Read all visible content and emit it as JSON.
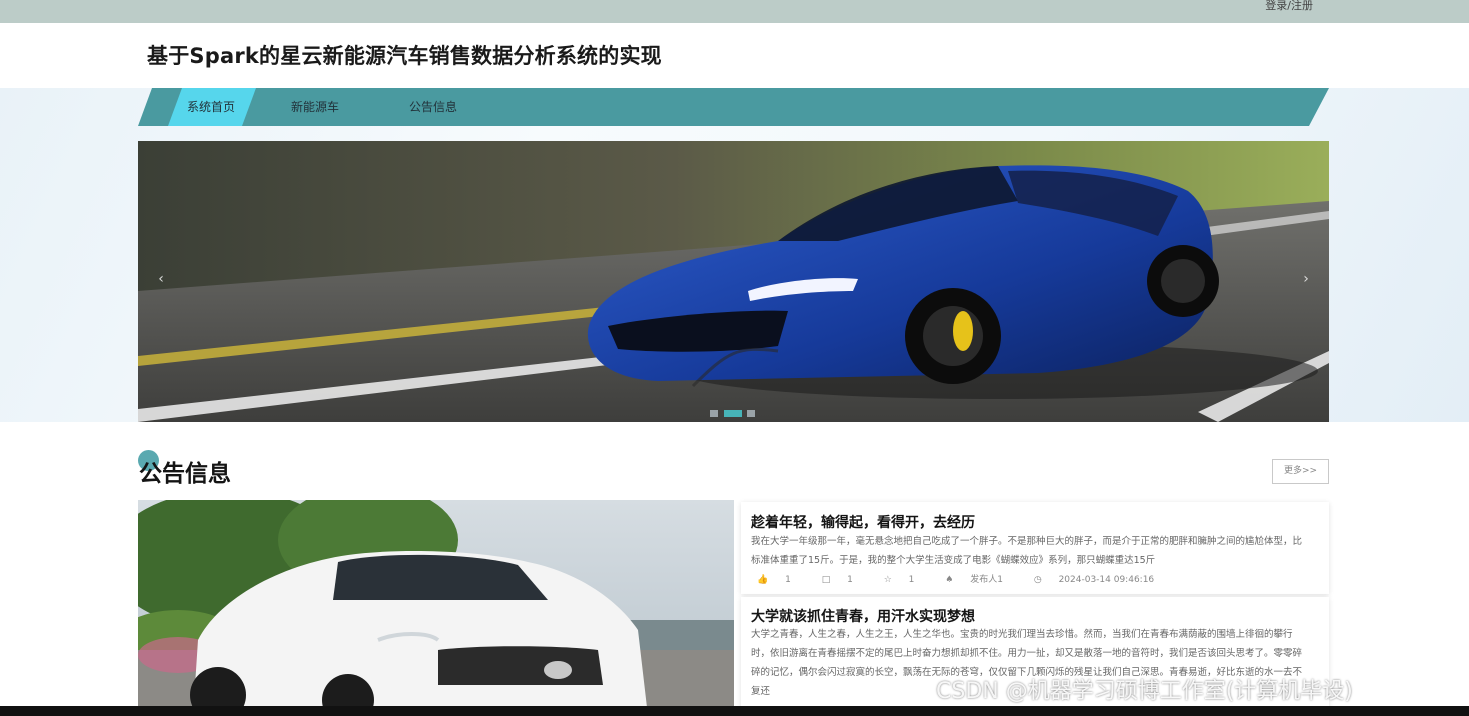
{
  "topbar": {
    "login_label": "登录/注册"
  },
  "header": {
    "title": "基于Spark的星云新能源汽车销售数据分析系统的实现"
  },
  "nav": {
    "items": [
      {
        "label": "系统首页"
      },
      {
        "label": "新能源车"
      },
      {
        "label": "公告信息"
      }
    ]
  },
  "carousel": {
    "prev_icon": "‹",
    "next_icon": "›",
    "slide_count": 3,
    "active_slide": 2
  },
  "section": {
    "title": "公告信息",
    "more_label": "更多>>"
  },
  "news": [
    {
      "title": "趁着年轻，输得起，看得开，去经历",
      "body": "我在大学一年级那一年，毫无悬念地把自己吃成了一个胖子。不是那种巨大的胖子，而是介于正常的肥胖和臃肿之间的尴尬体型，比标准体重重了15斤。于是，我的整个大学生活变成了电影《蝴蝶效应》系列，那只蝴蝶重达15斤",
      "likes": "1",
      "comments": "1",
      "favorites": "1",
      "author": "发布人1",
      "time": "2024-03-14 09:46:16"
    },
    {
      "title": "大学就该抓住青春，用汗水实现梦想",
      "body": "大学之青春，人生之春，人生之王，人生之华也。宝贵的时光我们理当去珍惜。然而，当我们在青春布满荫蔽的围墙上徘徊的攀行时，依旧游离在青春摇摆不定的尾巴上时奋力想抓却抓不住。用力一扯，却又是散落一地的音符时，我们是否该回头思考了。零零碎碎的记忆，偶尔会闪过寂寞的长空，飘荡在无际的苍穹，仅仅留下几颗闪烁的残星让我们自己深思。青春易逝，好比东逝的水一去不复还"
    }
  ],
  "watermark": "CSDN @机器学习硕博工作室(计算机毕设)",
  "colors": {
    "nav_teal": "#4a9aa0",
    "nav_active": "#56d6ec",
    "accent_circle": "#5aa9b0",
    "active_dot": "#47b4b8"
  }
}
